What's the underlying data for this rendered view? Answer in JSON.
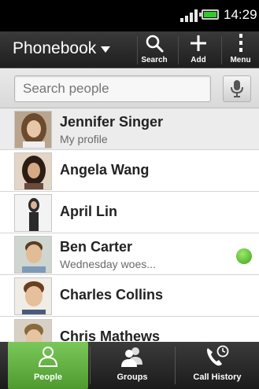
{
  "status_bar": {
    "time": "14:29",
    "signal_icon": "signal-icon",
    "battery_icon": "battery-icon"
  },
  "action_bar": {
    "title": "Phonebook",
    "search_label": "Search",
    "add_label": "Add",
    "menu_label": "Menu"
  },
  "search": {
    "placeholder": "Search people",
    "mic_icon": "microphone-icon"
  },
  "contacts": [
    {
      "name": "Jennifer Singer",
      "subtitle": "My profile",
      "is_profile": true
    },
    {
      "name": "Angela Wang",
      "subtitle": ""
    },
    {
      "name": "April Lin",
      "subtitle": ""
    },
    {
      "name": "Ben Carter",
      "subtitle": "Wednesday woes...",
      "online": true
    },
    {
      "name": "Charles Collins",
      "subtitle": ""
    },
    {
      "name": "Chris Mathews",
      "subtitle": ""
    }
  ],
  "tabs": [
    {
      "label": "People",
      "active": true,
      "icon": "people-icon"
    },
    {
      "label": "Groups",
      "active": false,
      "icon": "groups-icon"
    },
    {
      "label": "Call History",
      "active": false,
      "icon": "call-history-icon"
    }
  ],
  "colors": {
    "online_status": "#4caf2a",
    "active_tab": "#6bb84a"
  }
}
